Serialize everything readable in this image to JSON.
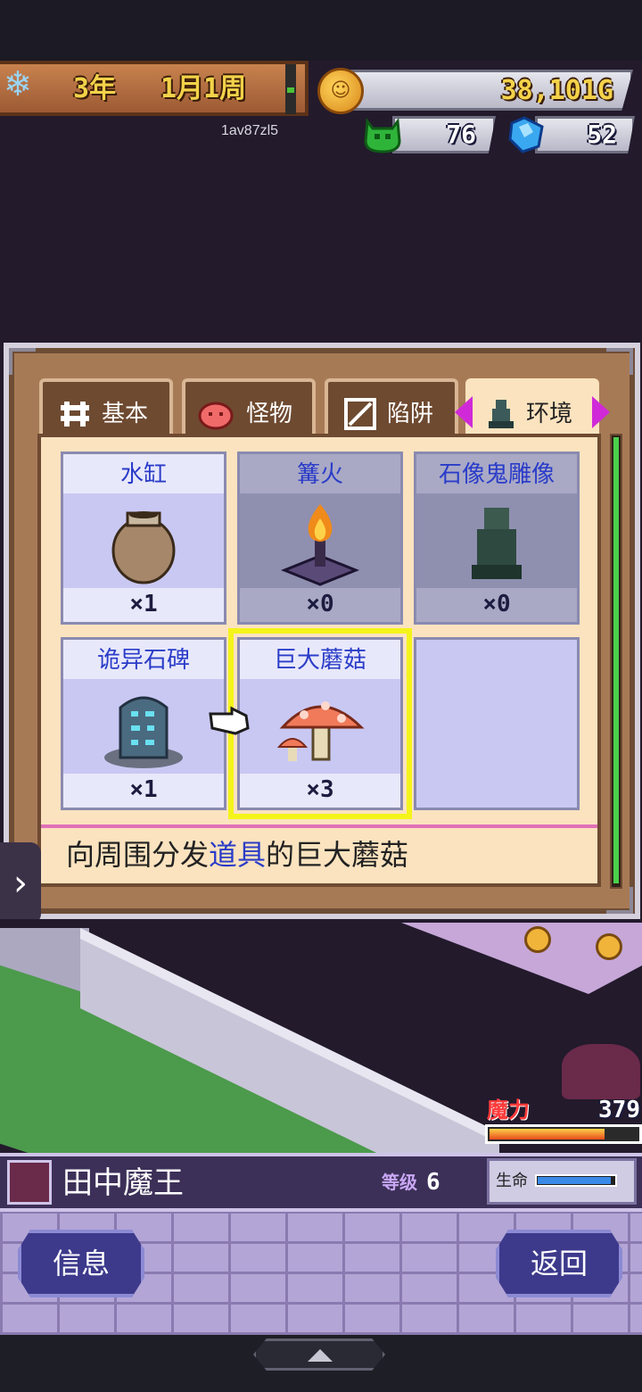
{
  "header": {
    "year_label": "3年",
    "week_label": "1月1周",
    "player_id": "1av87zl5",
    "gold": "38,101G",
    "resource_a": "76",
    "resource_b": "52",
    "icons": [
      "snowflake-icon",
      "gold-coin-icon",
      "green-monster-icon",
      "blue-crystal-icon"
    ]
  },
  "tabs": [
    {
      "label": "基本",
      "icon": "fence-icon"
    },
    {
      "label": "怪物",
      "icon": "slime-icon"
    },
    {
      "label": "陷阱",
      "icon": "trap-icon"
    },
    {
      "label": "环境",
      "icon": "statue-icon",
      "active": true
    }
  ],
  "items": [
    {
      "name": "水缸",
      "count": "×1",
      "icon": "jar-icon"
    },
    {
      "name": "篝火",
      "count": "×0",
      "icon": "bonfire-icon"
    },
    {
      "name": "石像鬼雕像",
      "count": "×0",
      "icon": "gargoyle-statue-icon"
    },
    {
      "name": "诡异石碑",
      "count": "×1",
      "icon": "rune-stone-icon"
    },
    {
      "name": "巨大蘑菇",
      "count": "×3",
      "icon": "mushroom-icon",
      "selected": true
    }
  ],
  "description": {
    "before": "向周围分发",
    "highlight": "道具",
    "after": "的巨大蘑菇"
  },
  "scene": {
    "mana_label": "魔力",
    "mana_value": "379",
    "mana_fill": 0.78
  },
  "status": {
    "player_name": "田中魔王",
    "level_label": "等级",
    "level_value": "6",
    "hp_label": "生命",
    "hp_fill": 0.95
  },
  "buttons": {
    "info": "信息",
    "back": "返回"
  },
  "colors": {
    "accent_blue": "#2a3cc8",
    "highlight_yellow": "#f4f41a",
    "panel_brown": "#a77a56"
  }
}
